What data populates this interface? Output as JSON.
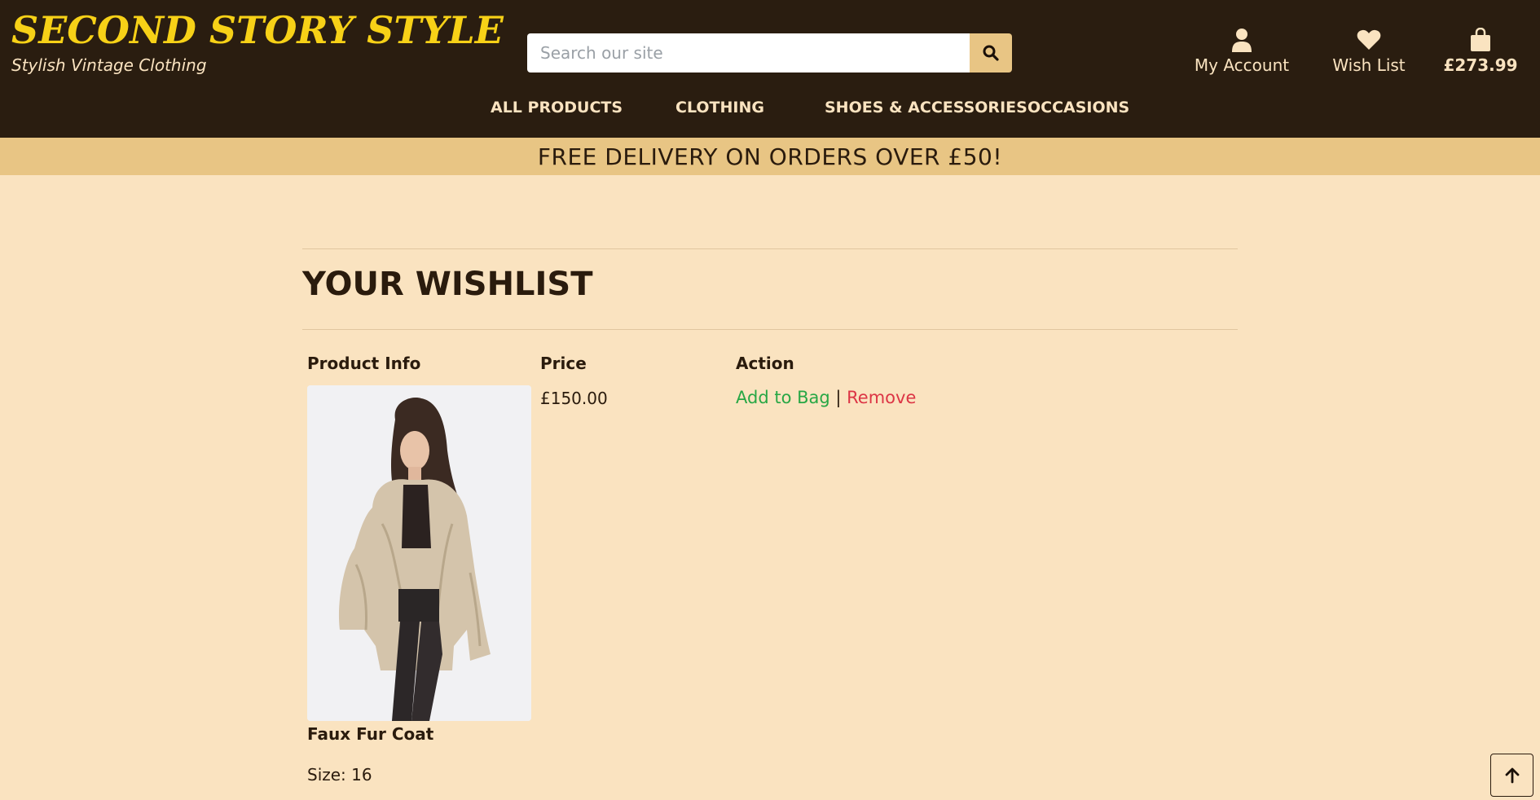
{
  "brand": {
    "name": "SECOND STORY STYLE",
    "tagline": "Stylish Vintage Clothing",
    "accent_color": "#f7d117",
    "header_bg": "#2a1d10",
    "page_bg": "#fae3c0"
  },
  "search": {
    "placeholder": "Search our site",
    "button_icon": "search-icon"
  },
  "header_links": {
    "account": {
      "label": "My Account",
      "icon": "user-icon"
    },
    "wishlist": {
      "label": "Wish List",
      "icon": "heart-icon"
    },
    "bag": {
      "total": "£273.99",
      "icon": "shopping-bag-icon"
    }
  },
  "main_nav": [
    "ALL PRODUCTS",
    "CLOTHING",
    "SHOES & ACCESSORIES",
    "OCCASIONS"
  ],
  "banner": {
    "text": "FREE DELIVERY ON ORDERS OVER £50!",
    "bg": "#e8c584"
  },
  "page": {
    "title": "YOUR WISHLIST",
    "columns": [
      "Product Info",
      "Price",
      "Action"
    ],
    "items": [
      {
        "name": "Faux Fur Coat",
        "size": "Size: 16",
        "price": "£150.00",
        "add_label": "Add to Bag",
        "separator": "|",
        "remove_label": "Remove"
      }
    ]
  },
  "back_to_top": {
    "icon": "arrow-up-icon"
  }
}
